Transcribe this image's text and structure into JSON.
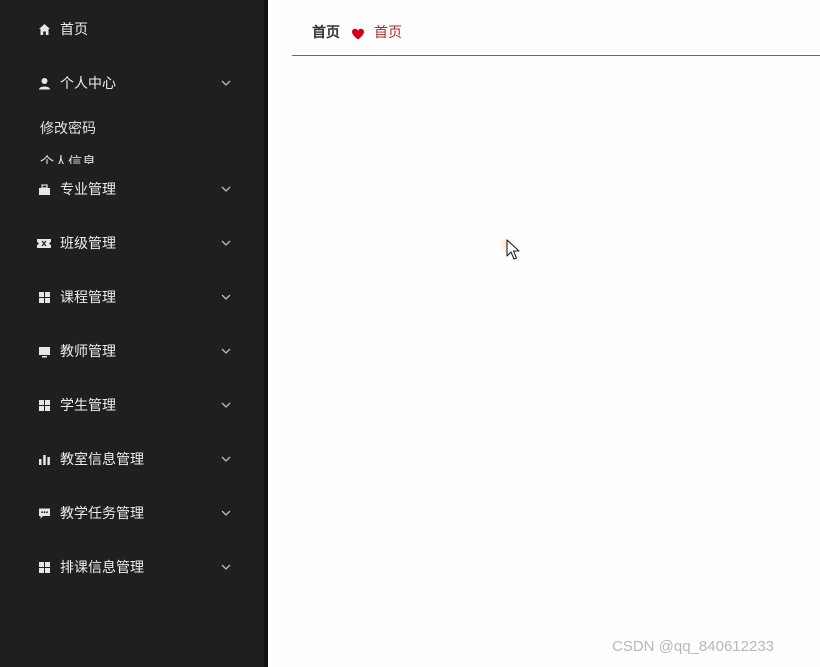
{
  "sidebar": {
    "items": [
      {
        "label": "首页",
        "icon": "home-icon"
      },
      {
        "label": "个人中心",
        "icon": "user-icon",
        "expanded": true,
        "children": [
          {
            "label": "修改密码"
          },
          {
            "label": "个人信息"
          }
        ]
      },
      {
        "label": "专业管理",
        "icon": "briefcase-icon"
      },
      {
        "label": "班级管理",
        "icon": "ticket-icon"
      },
      {
        "label": "课程管理",
        "icon": "grid-icon"
      },
      {
        "label": "教师管理",
        "icon": "monitor-icon"
      },
      {
        "label": "学生管理",
        "icon": "grid-icon"
      },
      {
        "label": "教室信息管理",
        "icon": "bar-chart-icon"
      },
      {
        "label": "教学任务管理",
        "icon": "chat-icon"
      },
      {
        "label": "排课信息管理",
        "icon": "grid-icon"
      }
    ]
  },
  "breadcrumb": {
    "home": "首页",
    "current": "首页",
    "separator_icon": "heart-icon"
  },
  "watermark": "CSDN @qq_840612233",
  "colors": {
    "sidebar_bg": "#1f1f1f",
    "accent": "#b3262a",
    "separator": "#d0021b"
  }
}
